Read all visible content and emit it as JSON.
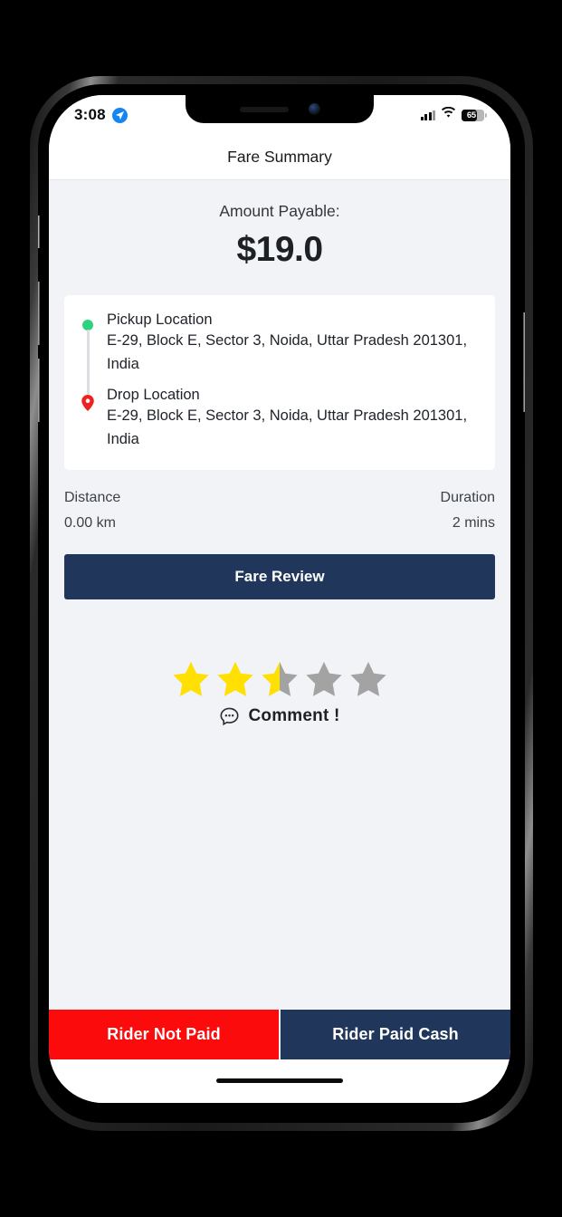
{
  "status_bar": {
    "time": "3:08",
    "location_icon": "location-arrow-icon",
    "cellular_icon": "cellular-bars-icon",
    "wifi_icon": "wifi-icon",
    "battery_level": "65",
    "battery_percent": 65
  },
  "header": {
    "title": "Fare Summary"
  },
  "fare": {
    "amount_label": "Amount Payable:",
    "amount_value": "$19.0"
  },
  "locations": {
    "pickup": {
      "title": "Pickup Location",
      "address": "E-29, Block E, Sector 3, Noida, Uttar Pradesh 201301, India",
      "marker_icon": "green-dot-icon"
    },
    "drop": {
      "title": "Drop Location",
      "address": "E-29, Block E, Sector 3, Noida, Uttar Pradesh 201301, India",
      "marker_icon": "red-map-pin-icon"
    }
  },
  "trip_stats": {
    "distance_label": "Distance",
    "distance_value": "0.00 km",
    "duration_label": "Duration",
    "duration_value": "2 mins"
  },
  "fare_review": {
    "label": "Fare Review"
  },
  "rating": {
    "value": 2.5,
    "max": 5,
    "star_icon": "star-icon",
    "comment_icon": "comment-bubble-icon",
    "comment_label": "Comment !"
  },
  "bottom_actions": {
    "not_paid_label": "Rider Not Paid",
    "paid_cash_label": "Rider Paid Cash"
  },
  "colors": {
    "navy": "#20375b",
    "red": "#fb0b0b",
    "star_yellow": "#ffe000",
    "star_gray": "#a3a3a3",
    "pickup_green": "#2dd27f",
    "drop_red": "#ef2020",
    "page_bg": "#f1f3f7"
  }
}
